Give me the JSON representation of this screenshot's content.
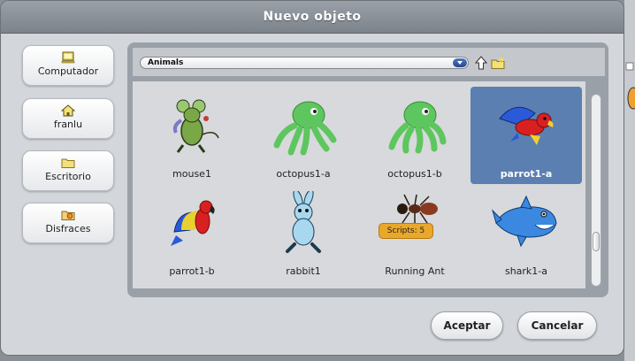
{
  "dialog": {
    "title": "Nuevo objeto"
  },
  "sidebar": {
    "items": [
      {
        "label": "Computador",
        "icon": "computer-icon"
      },
      {
        "label": "franlu",
        "icon": "home-icon"
      },
      {
        "label": "Escritorio",
        "icon": "folder-icon"
      },
      {
        "label": "Disfraces",
        "icon": "costumes-folder-icon"
      }
    ]
  },
  "browser": {
    "folder_select": {
      "value": "Animals"
    },
    "items": [
      {
        "name": "mouse1",
        "icon": "mouse-icon",
        "selected": false
      },
      {
        "name": "octopus1-a",
        "icon": "octopus-icon",
        "selected": false
      },
      {
        "name": "octopus1-b",
        "icon": "octopus-icon",
        "selected": false
      },
      {
        "name": "parrot1-a",
        "icon": "parrot-icon",
        "selected": true
      },
      {
        "name": "parrot1-b",
        "icon": "parrot-icon",
        "selected": false
      },
      {
        "name": "rabbit1",
        "icon": "rabbit-icon",
        "selected": false
      },
      {
        "name": "Running Ant",
        "icon": "ant-icon",
        "selected": false,
        "badge": "Scripts: 5"
      },
      {
        "name": "shark1-a",
        "icon": "shark-icon",
        "selected": false
      }
    ]
  },
  "footer": {
    "accept_label": "Aceptar",
    "cancel_label": "Cancelar"
  },
  "colors": {
    "selection": "#5b7fb0",
    "titlebar": "#7d838b",
    "badge": "#e9a82a"
  }
}
